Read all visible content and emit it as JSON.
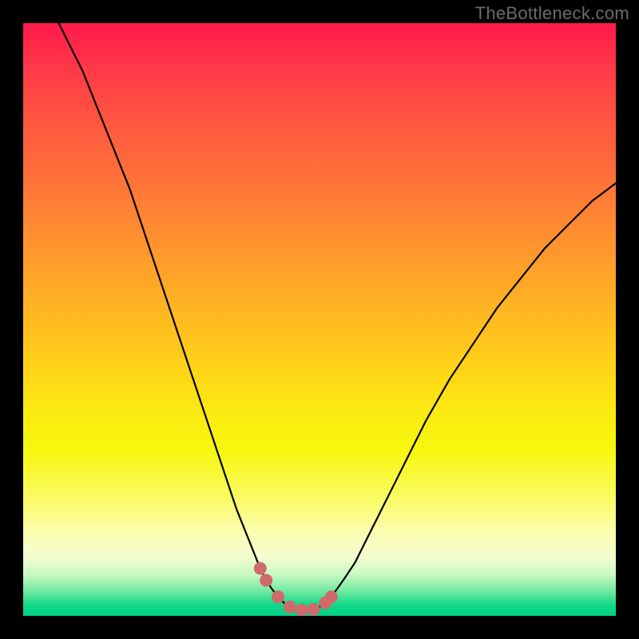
{
  "watermark": "TheBottleneck.com",
  "chart_data": {
    "type": "line",
    "title": "",
    "xlabel": "",
    "ylabel": "",
    "xlim": [
      0,
      100
    ],
    "ylim": [
      0,
      100
    ],
    "grid": false,
    "legend": false,
    "background": "rainbow-gradient-vertical",
    "series": [
      {
        "name": "bottleneck-curve",
        "color": "#000000",
        "x": [
          6,
          8,
          10,
          12,
          14,
          16,
          18,
          20,
          22,
          24,
          26,
          28,
          30,
          32,
          34,
          36,
          38,
          40,
          41,
          42,
          43,
          44,
          45,
          46,
          47,
          48,
          49,
          50,
          51,
          52,
          54,
          56,
          58,
          60,
          62,
          65,
          68,
          72,
          76,
          80,
          84,
          88,
          92,
          96,
          100
        ],
        "y": [
          100,
          96,
          92,
          87,
          82,
          77,
          72,
          66,
          60,
          54,
          48,
          42,
          36,
          30,
          24,
          18,
          13,
          8,
          6,
          4.5,
          3.2,
          2.2,
          1.5,
          1.1,
          1.0,
          1.0,
          1.1,
          1.5,
          2.2,
          3.2,
          6,
          9,
          13,
          17,
          21,
          27,
          33,
          40,
          46,
          52,
          57,
          62,
          66,
          70,
          73
        ]
      }
    ],
    "markers": {
      "name": "highlighted-points",
      "color": "#cf6a6a",
      "radius_px": 8,
      "x": [
        40,
        41,
        43,
        45,
        47,
        49,
        51,
        52
      ],
      "y": [
        8,
        6,
        3.2,
        1.5,
        1.0,
        1.1,
        2.2,
        3.2
      ]
    }
  }
}
